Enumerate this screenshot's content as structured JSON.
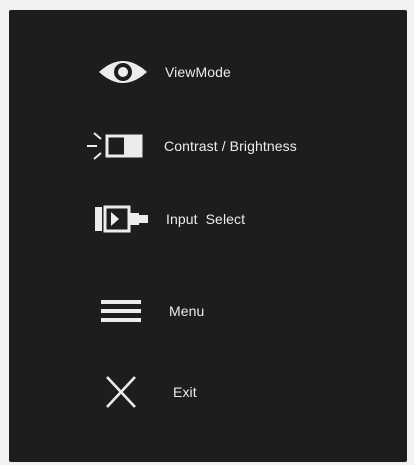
{
  "osd_menu": {
    "items": [
      {
        "label": "ViewMode",
        "icon": "eye-icon"
      },
      {
        "label": "Contrast / Brightness",
        "icon": "contrast-brightness-icon"
      },
      {
        "label": "Input  Select",
        "icon": "input-select-icon"
      },
      {
        "label": "Menu",
        "icon": "hamburger-menu-icon"
      },
      {
        "label": "Exit",
        "icon": "close-x-icon"
      }
    ]
  },
  "colors": {
    "panel_background": "#1d1d1d",
    "page_background": "#f2f2f2",
    "foreground": "#ececec"
  }
}
